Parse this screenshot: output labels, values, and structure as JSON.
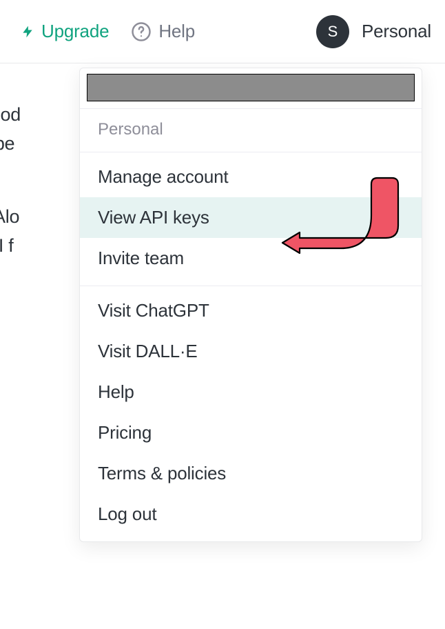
{
  "topbar": {
    "upgrade_label": "Upgrade",
    "help_label": "Help",
    "avatar_letter": "S",
    "account_label": "Personal"
  },
  "background_text": {
    "line1": "ry good",
    "line2": "can be",
    "line3": "ion. Alo",
    "line4": "e API f"
  },
  "dropdown": {
    "section_label": "Personal",
    "group1": {
      "manage_account": "Manage account",
      "view_api_keys": "View API keys",
      "invite_team": "Invite team"
    },
    "group2": {
      "visit_chatgpt": "Visit ChatGPT",
      "visit_dalle": "Visit DALL·E",
      "help": "Help",
      "pricing": "Pricing",
      "terms": "Terms & policies",
      "log_out": "Log out"
    }
  },
  "colors": {
    "accent_green": "#10a37f",
    "text_primary": "#2d333a",
    "text_muted": "#707582",
    "highlight_bg": "#e6f3f2",
    "annotation_red": "#ef5565"
  }
}
